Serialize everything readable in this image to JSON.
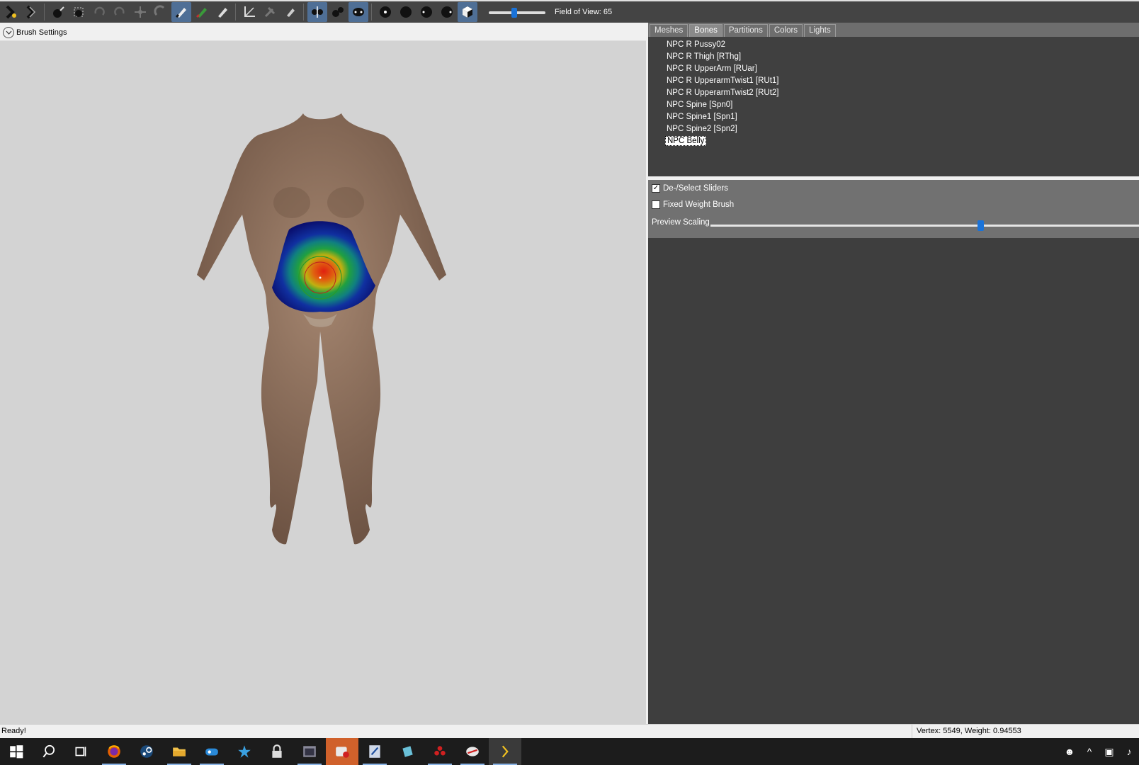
{
  "toolbar": {
    "fov_label": "Field of View: 65"
  },
  "viewport": {
    "brush_settings_label": "Brush Settings"
  },
  "right_panel": {
    "tabs": [
      "Meshes",
      "Bones",
      "Partitions",
      "Colors",
      "Lights"
    ],
    "active_tab": "Bones",
    "bones": [
      "NPC R Pussy02",
      "NPC R Thigh [RThg]",
      "NPC R UpperArm [RUar]",
      "NPC R UpperarmTwist1 [RUt1]",
      "NPC R UpperarmTwist2 [RUt2]",
      "NPC Spine [Spn0]",
      "NPC Spine1 [Spn1]",
      "NPC Spine2 [Spn2]",
      "NPC Belly"
    ],
    "selected_bone": "NPC Belly",
    "checkboxes": {
      "deselect_sliders": {
        "label": "De-/Select Sliders",
        "checked": true
      },
      "fixed_weight": {
        "label": "Fixed Weight Brush",
        "checked": false
      }
    },
    "preview_scaling_label": "Preview Scaling",
    "preview_scaling_value": 0.63
  },
  "status": {
    "left": "Ready!",
    "right": "Vertex: 5549, Weight: 0.94553"
  },
  "colors": {
    "toolbar_bg": "#444444",
    "accent_blue": "#1a73d9",
    "panel_dark": "#404040",
    "viewport_bg": "#d3d3d3"
  }
}
